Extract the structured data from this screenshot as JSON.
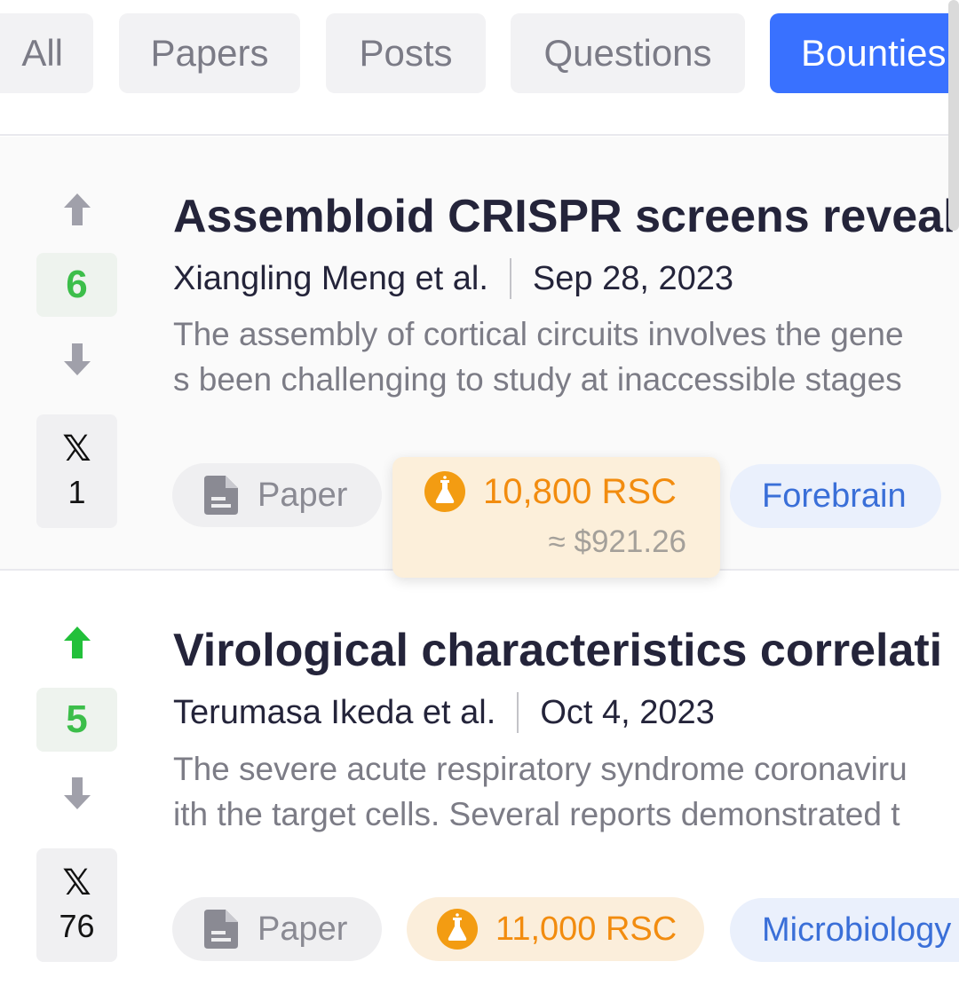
{
  "tabs": [
    {
      "label": "All",
      "active": false
    },
    {
      "label": "Papers",
      "active": false
    },
    {
      "label": "Posts",
      "active": false
    },
    {
      "label": "Questions",
      "active": false
    },
    {
      "label": "Bounties",
      "active": true
    }
  ],
  "colors": {
    "accent": "#3971ff",
    "upvote_active": "#22c03a",
    "arrow_inactive": "#a0a0aa",
    "score_text": "#3cbe4a",
    "bounty": "#f28c0f",
    "hub_text": "#3a6fd8"
  },
  "items": [
    {
      "score": "6",
      "upvoted": false,
      "x_label": "𝕏",
      "x_count": "1",
      "title": "Assembloid CRISPR screens reveal",
      "authors": "Xiangling Meng et al.",
      "date": "Sep 28, 2023",
      "abstract_line1": "The assembly of cortical circuits involves the gene",
      "abstract_line2": "s been challenging to study at inaccessible stages",
      "type_label": "Paper",
      "bounty": "10,800 RSC",
      "bounty_usd": "≈ $921.26",
      "hub": "Forebrain"
    },
    {
      "score": "5",
      "upvoted": true,
      "x_label": "𝕏",
      "x_count": "76",
      "title": "Virological characteristics correlati",
      "authors": "Terumasa Ikeda et al.",
      "date": "Oct 4, 2023",
      "abstract_line1": "The severe acute respiratory syndrome coronaviru",
      "abstract_line2": "ith the target cells. Several reports demonstrated t",
      "type_label": "Paper",
      "bounty": "11,000 RSC",
      "hub": "Microbiology"
    }
  ]
}
